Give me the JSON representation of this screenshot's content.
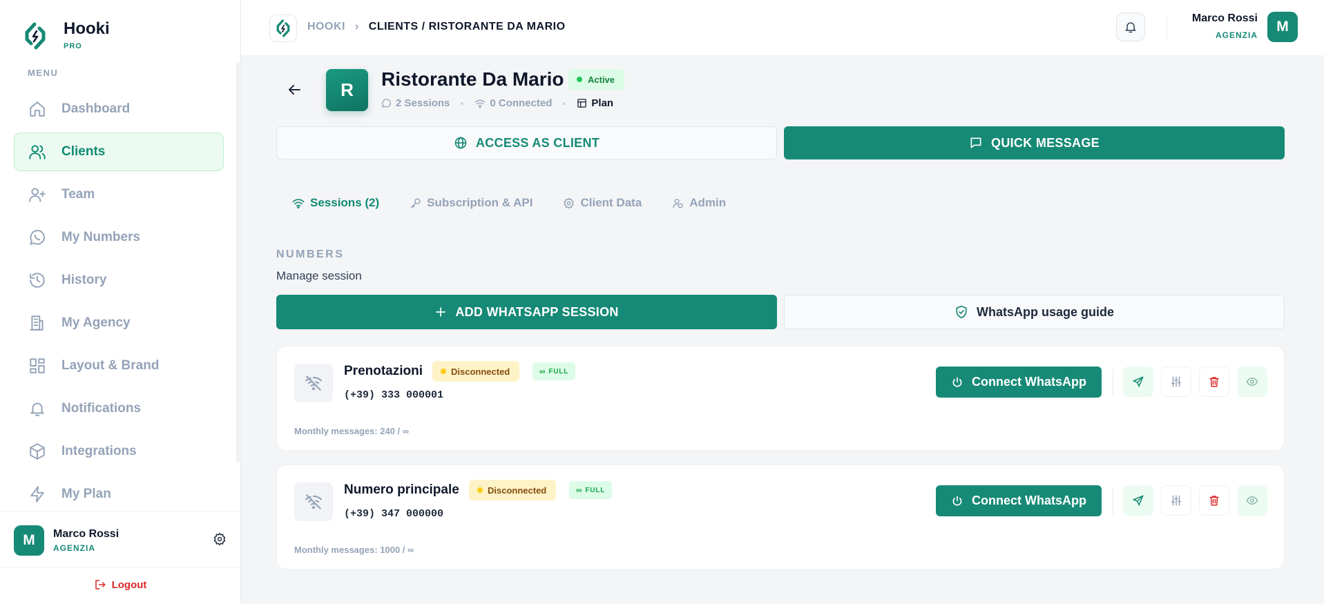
{
  "brand": {
    "name": "Hooki",
    "tier": "PRO"
  },
  "sidebar": {
    "menu_caption": "MENU",
    "items": [
      {
        "label": "Dashboard",
        "icon": "home-icon",
        "active": false
      },
      {
        "label": "Clients",
        "icon": "users-icon",
        "active": true
      },
      {
        "label": "Team",
        "icon": "user-plus-icon",
        "active": false
      },
      {
        "label": "My Numbers",
        "icon": "whatsapp-icon",
        "active": false
      },
      {
        "label": "History",
        "icon": "history-icon",
        "active": false
      },
      {
        "label": "My Agency",
        "icon": "building-icon",
        "active": false
      },
      {
        "label": "Layout & Brand",
        "icon": "layout-icon",
        "active": false
      },
      {
        "label": "Notifications",
        "icon": "bell-icon",
        "active": false
      },
      {
        "label": "Integrations",
        "icon": "box-icon",
        "active": false
      },
      {
        "label": "My Plan",
        "icon": "bolt-icon",
        "active": false
      }
    ],
    "user": {
      "initial": "M",
      "name": "Marco Rossi",
      "role": "AGENZIA"
    },
    "logout_label": "Logout"
  },
  "header": {
    "breadcrumb_root": "HOOKI",
    "breadcrumb_current": "CLIENTS / RISTORANTE DA MARIO",
    "user": {
      "initial": "M",
      "name": "Marco Rossi",
      "role": "AGENZIA"
    }
  },
  "client": {
    "initial": "R",
    "name": "Ristorante Da Mario",
    "status": "Active",
    "sessions": "2 Sessions",
    "connected": "0 Connected",
    "plan": "Plan"
  },
  "actions": {
    "access_label": "ACCESS AS CLIENT",
    "quick_label": "QUICK MESSAGE"
  },
  "tabs": [
    {
      "label": "Sessions (2)",
      "icon": "wifi-icon",
      "active": true
    },
    {
      "label": "Subscription & API",
      "icon": "key-icon",
      "active": false
    },
    {
      "label": "Client Data",
      "icon": "gear-icon",
      "active": false
    },
    {
      "label": "Admin",
      "icon": "user-shield-icon",
      "active": false
    }
  ],
  "numbers": {
    "title": "NUMBERS",
    "subtitle": "Manage session",
    "add_label": "ADD WHATSAPP SESSION",
    "guide_label": "WhatsApp usage guide",
    "sessions": [
      {
        "name": "Prenotazioni",
        "status": "Disconnected",
        "tier": "FULL",
        "phone": "(+39) 333 000001",
        "monthly": "Monthly messages: 240 / ∞",
        "connect_label": "Connect WhatsApp"
      },
      {
        "name": "Numero principale",
        "status": "Disconnected",
        "tier": "FULL",
        "phone": "(+39) 347 000000",
        "monthly": "Monthly messages: 1000 / ∞",
        "connect_label": "Connect WhatsApp"
      }
    ]
  },
  "colors": {
    "primary": "#168a76",
    "active_bg": "#ecfbf1",
    "warning_bg": "#fef3c7",
    "danger": "#dc2626"
  }
}
